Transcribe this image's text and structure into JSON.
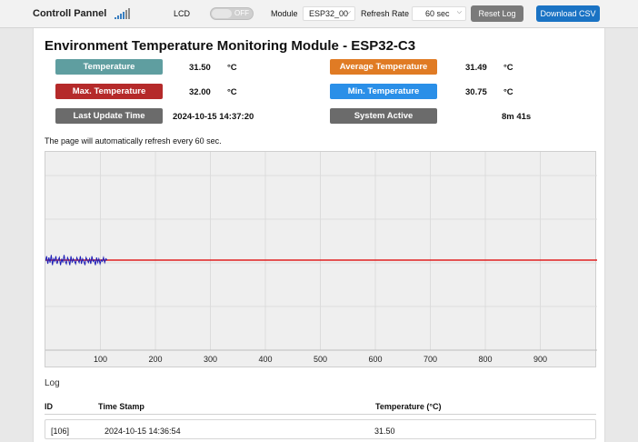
{
  "header": {
    "app_title": "Controll Pannel",
    "lcd_label": "LCD",
    "lcd_toggle_text": "OFF",
    "module_label": "Module",
    "module_value": "ESP32_00",
    "refresh_label": "Refresh Rate",
    "refresh_value": "60 sec",
    "reset_log_label": "Reset Log",
    "download_csv_label": "Download CSV"
  },
  "main": {
    "title": "Environment Temperature Monitoring Module - ESP32-C3",
    "stats": {
      "temperature": {
        "label": "Temperature",
        "value": "31.50",
        "unit": "°C"
      },
      "avg_temperature": {
        "label": "Average Temperature",
        "value": "31.49",
        "unit": "°C"
      },
      "max_temperature": {
        "label": "Max. Temperature",
        "value": "32.00",
        "unit": "°C"
      },
      "min_temperature": {
        "label": "Min. Temperature",
        "value": "30.75",
        "unit": "°C"
      },
      "last_update": {
        "label": "Last Update Time",
        "value": "2024-10-15 14:37:20"
      },
      "system_active": {
        "label": "System Active",
        "value": "8m 41s"
      }
    },
    "refresh_note": "The page will automatically refresh every 60 sec."
  },
  "colors": {
    "temperature": "#5f9ea0",
    "avg_temperature": "#e07b24",
    "max_temperature": "#b52a2a",
    "min_temperature": "#2a8fe8",
    "neutral": "#6b6b6b",
    "series": "#1f1fb8",
    "average_line": "#e02020"
  },
  "chart_data": {
    "type": "line",
    "x_ticks": [
      "100",
      "200",
      "300",
      "400",
      "500",
      "600",
      "700",
      "800",
      "900"
    ],
    "xlim": [
      0,
      1000
    ],
    "ylim": [
      29,
      34
    ],
    "grid": true,
    "series": [
      {
        "values": [
          31.4,
          31.8,
          31.2,
          31.7,
          31.3,
          31.9,
          31.1,
          31.6,
          31.4,
          31.8,
          31.2,
          31.5,
          31.7,
          31.1,
          31.6,
          31.3,
          31.9,
          31.4,
          31.2,
          31.7,
          31.5,
          31.1,
          31.8,
          31.3,
          31.6,
          31.4,
          31.2,
          31.7,
          31.5,
          31.3,
          31.8,
          31.2,
          31.6,
          31.4,
          31.1,
          31.7,
          31.5,
          31.3,
          31.6,
          31.2,
          31.8,
          31.4,
          31.5,
          31.1,
          31.7,
          31.3,
          31.6,
          31.2,
          31.5,
          31.4,
          31.7,
          31.3,
          31.6,
          31.5
        ]
      },
      {
        "values": [
          31.49,
          31.49
        ]
      }
    ]
  },
  "log": {
    "title": "Log",
    "columns": [
      "ID",
      "Time Stamp",
      "Temperature (°C)"
    ],
    "rows": [
      {
        "id": "[106]",
        "timestamp": "2024-10-15 14:36:54",
        "temperature": "31.50"
      }
    ]
  }
}
